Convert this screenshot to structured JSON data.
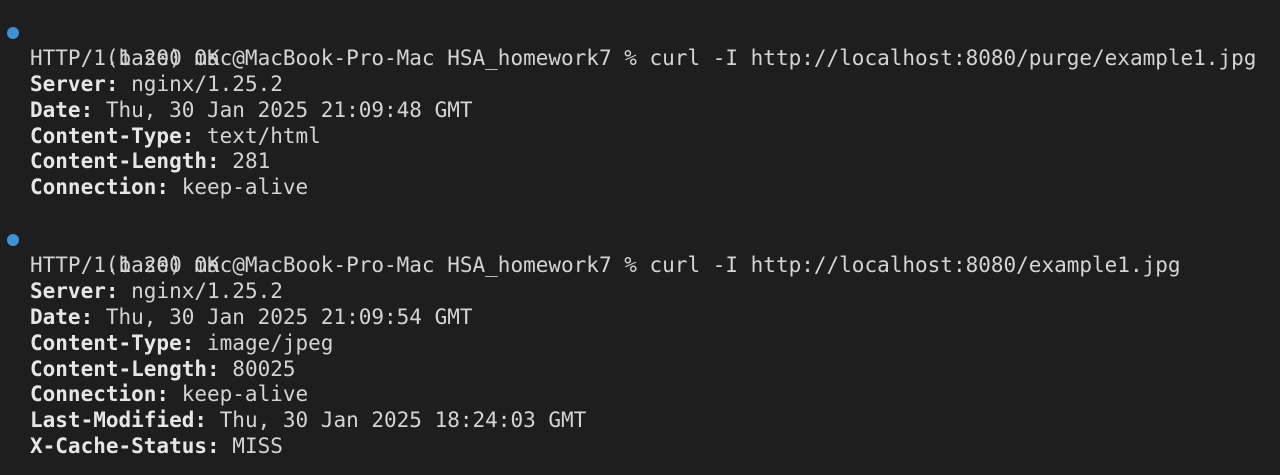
{
  "colors": {
    "background": "#1e1e1e",
    "text": "#d4d4d4",
    "prompt_dot": "#3a93d6"
  },
  "blocks": [
    {
      "prompt": "(base) mac@MacBook-Pro-Mac HSA_homework7 % curl -I http://localhost:8080/purge/example1.jpg",
      "status": "HTTP/1.1 200 OK",
      "headers": [
        {
          "key": "Server:",
          "value": " nginx/1.25.2"
        },
        {
          "key": "Date:",
          "value": " Thu, 30 Jan 2025 21:09:48 GMT"
        },
        {
          "key": "Content-Type:",
          "value": " text/html"
        },
        {
          "key": "Content-Length:",
          "value": " 281"
        },
        {
          "key": "Connection:",
          "value": " keep-alive"
        }
      ]
    },
    {
      "prompt": "(base) mac@MacBook-Pro-Mac HSA_homework7 % curl -I http://localhost:8080/example1.jpg",
      "status": "HTTP/1.1 200 OK",
      "headers": [
        {
          "key": "Server:",
          "value": " nginx/1.25.2"
        },
        {
          "key": "Date:",
          "value": " Thu, 30 Jan 2025 21:09:54 GMT"
        },
        {
          "key": "Content-Type:",
          "value": " image/jpeg"
        },
        {
          "key": "Content-Length:",
          "value": " 80025"
        },
        {
          "key": "Connection:",
          "value": " keep-alive"
        },
        {
          "key": "Last-Modified:",
          "value": " Thu, 30 Jan 2025 18:24:03 GMT"
        },
        {
          "key": "X-Cache-Status:",
          "value": " MISS"
        }
      ]
    }
  ]
}
